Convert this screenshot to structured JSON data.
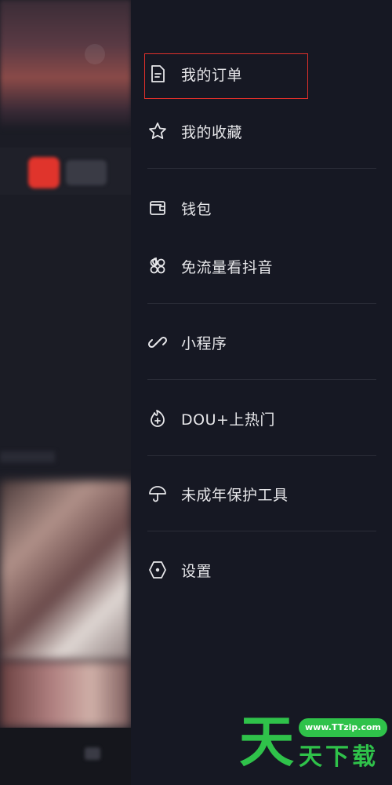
{
  "menu": {
    "items": [
      {
        "label": "我的订单",
        "icon": "order-doc-icon"
      },
      {
        "label": "我的收藏",
        "icon": "star-icon"
      },
      {
        "label": "钱包",
        "icon": "wallet-icon"
      },
      {
        "label": "免流量看抖音",
        "icon": "clover-icon"
      },
      {
        "label": "小程序",
        "icon": "link-icon"
      },
      {
        "label": "DOU+上热门",
        "icon": "flame-plus-icon"
      },
      {
        "label": "未成年保护工具",
        "icon": "umbrella-icon"
      },
      {
        "label": "设置",
        "icon": "hexagon-settings-icon"
      }
    ]
  },
  "colors": {
    "drawer_bg": "#161823",
    "text": "#e7e7ea",
    "highlight": "#e0302a",
    "watermark": "#2fc24a"
  },
  "watermark": {
    "big_char": "天",
    "url": "www.TTzip.com",
    "sub": "天下载"
  }
}
